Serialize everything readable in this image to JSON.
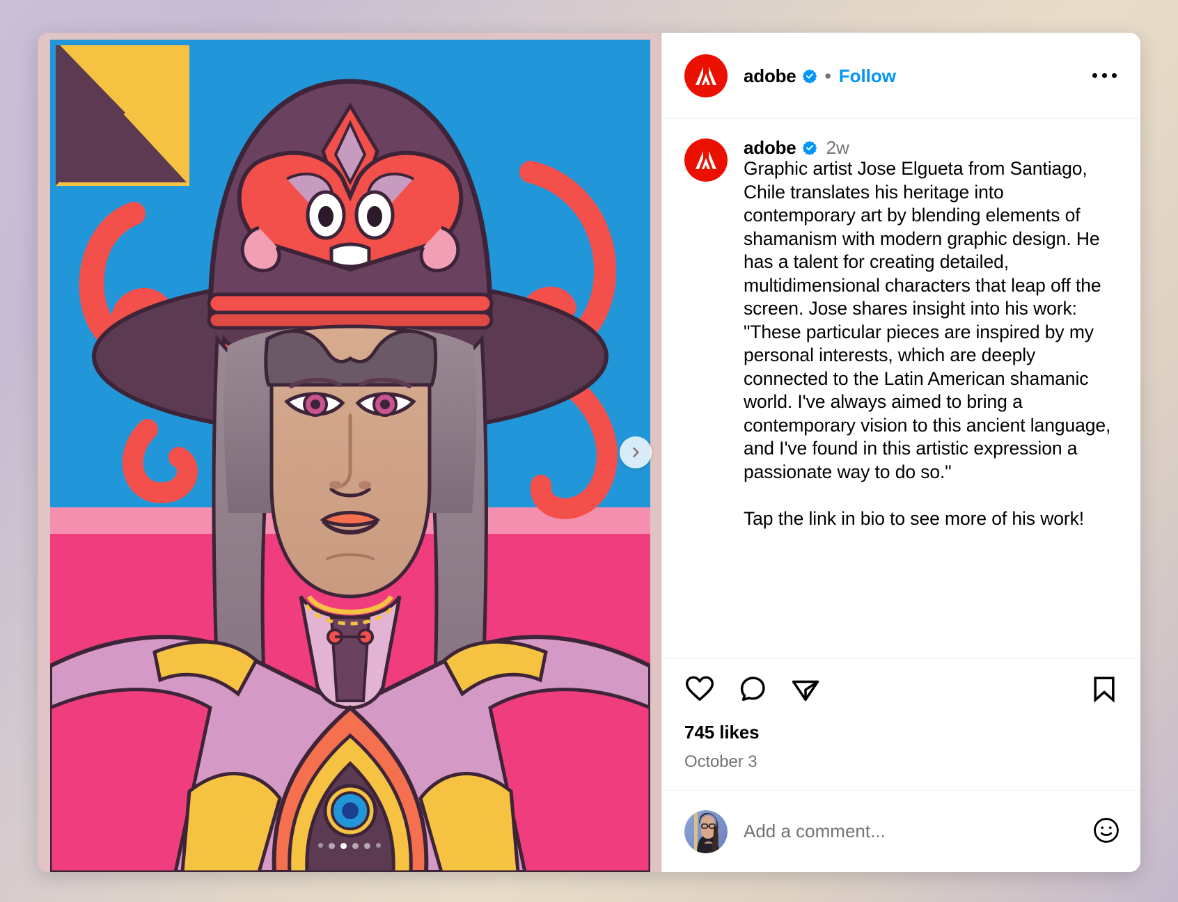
{
  "app": "instagram-post",
  "colors": {
    "brand_red": "#eb1000",
    "link_blue": "#0095f6",
    "verified_blue": "#0095f6",
    "secondary_text": "#737373",
    "card_background": "#ffffff"
  },
  "header": {
    "avatar_name": "adobe-avatar",
    "username": "adobe",
    "verified": true,
    "verified_icon": "verified-badge-icon",
    "separator": "•",
    "follow_label": "Follow",
    "more_icon": "more-options-icon"
  },
  "media": {
    "type": "carousel",
    "next_icon": "chevron-right-icon",
    "dots_total": 6,
    "dots_active_index": 2,
    "alt": "Illustrated portrait of a shamanic figure wearing a large purple hat with a red mask"
  },
  "caption": {
    "avatar_name": "adobe-avatar",
    "username": "adobe",
    "verified": true,
    "timestamp": "2w",
    "body": "Graphic artist Jose Elgueta from Santiago, Chile translates his heritage into contemporary art by blending elements of shamanism with modern graphic design. He has a talent for creating detailed, multidimensional characters that leap off the screen. Jose shares insight into his work: \"These particular pieces are inspired by my personal interests, which are deeply connected to the Latin American shamanic world. I've always aimed to bring a contemporary vision to this ancient language, and I've found in this artistic expression a passionate way to do so.\"\n\nTap the link in bio to see more of his work!"
  },
  "actions": {
    "like_icon": "heart-icon",
    "comment_icon": "comment-bubble-icon",
    "share_icon": "share-paper-plane-icon",
    "save_icon": "bookmark-icon",
    "likes_text": "745 likes",
    "date_text": "October 3"
  },
  "composer": {
    "avatar_name": "current-user-avatar",
    "placeholder": "Add a comment...",
    "value": "",
    "emoji_icon": "emoji-smiley-icon"
  }
}
